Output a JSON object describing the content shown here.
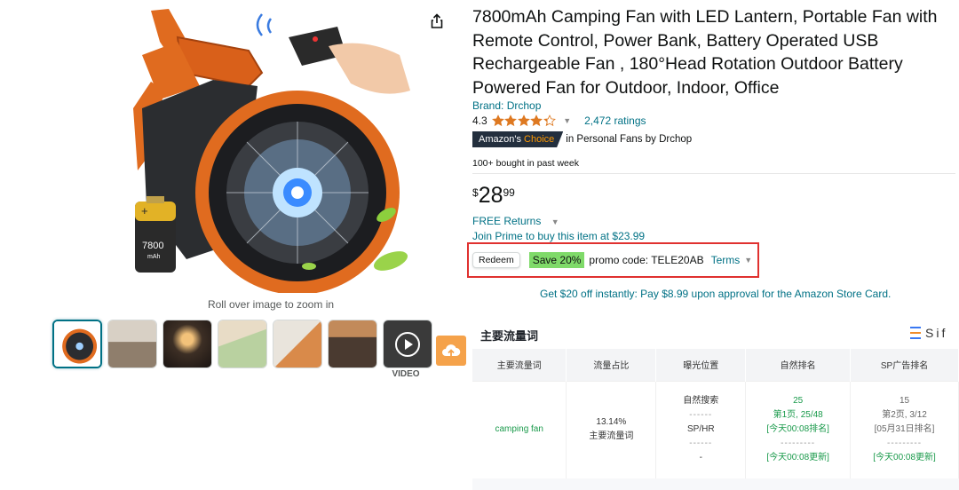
{
  "gallery": {
    "zoom_hint": "Roll over image to zoom in",
    "main_image_battery_label": "7800",
    "main_image_battery_unit": "mAh",
    "thumbnails": [
      "thumb-1",
      "thumb-2",
      "thumb-3",
      "thumb-4",
      "thumb-5",
      "thumb-6",
      "thumb-video"
    ],
    "video_label": "VIDEO"
  },
  "product": {
    "title": "7800mAh Camping Fan with LED Lantern, Portable Fan with Remote Control, Power Bank, Battery Operated USB Rechargeable Fan , 180°Head Rotation Outdoor Battery Powered Fan for Outdoor, Indoor, Office",
    "brand": "Brand: Drchop",
    "rating": "4.3",
    "stars_value": 4.3,
    "ratings_count": "2,472 ratings",
    "choice_badge_prefix": "Amazon's",
    "choice_badge_suffix": "Choice",
    "choice_category": "in Personal Fans by Drchop",
    "bought": "100+ bought in past week",
    "price_symbol": "$",
    "price_whole": "28",
    "price_fraction": "99",
    "free_returns": "FREE Returns",
    "prime_offer": "Join Prime to buy this item at $23.99",
    "promo": {
      "redeem": "Redeem",
      "save": "Save 20%",
      "code_text": "promo code: TELE20AB",
      "terms": "Terms"
    },
    "card_offer": "Get $20 off instantly: Pay $8.99 upon approval for the Amazon Store Card."
  },
  "keyword_panel": {
    "title": "主要流量词",
    "logo_text": "Sif",
    "columns": [
      "主要流量词",
      "流量占比",
      "曝光位置",
      "自然排名",
      "SP广告排名"
    ],
    "row": {
      "keyword": "camping fan",
      "share": "13.14%",
      "share_label": "主要流量词",
      "exposure_1": "自然搜索",
      "exposure_2": "SP/HR",
      "exposure_3": "-",
      "organic_rank": "25",
      "organic_page": "第1页, 25/48",
      "organic_time": "[今天00:08排名]",
      "organic_update": "[今天00:08更新]",
      "sp_rank": "15",
      "sp_page": "第2页, 3/12",
      "sp_time": "[05月31日排名]",
      "sp_update": "[今天00:08更新]"
    },
    "accent_color": "#1a9a4b"
  },
  "colors": {
    "link": "#007185",
    "highlight_box": "#e0312f",
    "save_badge": "#7fda69",
    "star": "#de7921"
  }
}
